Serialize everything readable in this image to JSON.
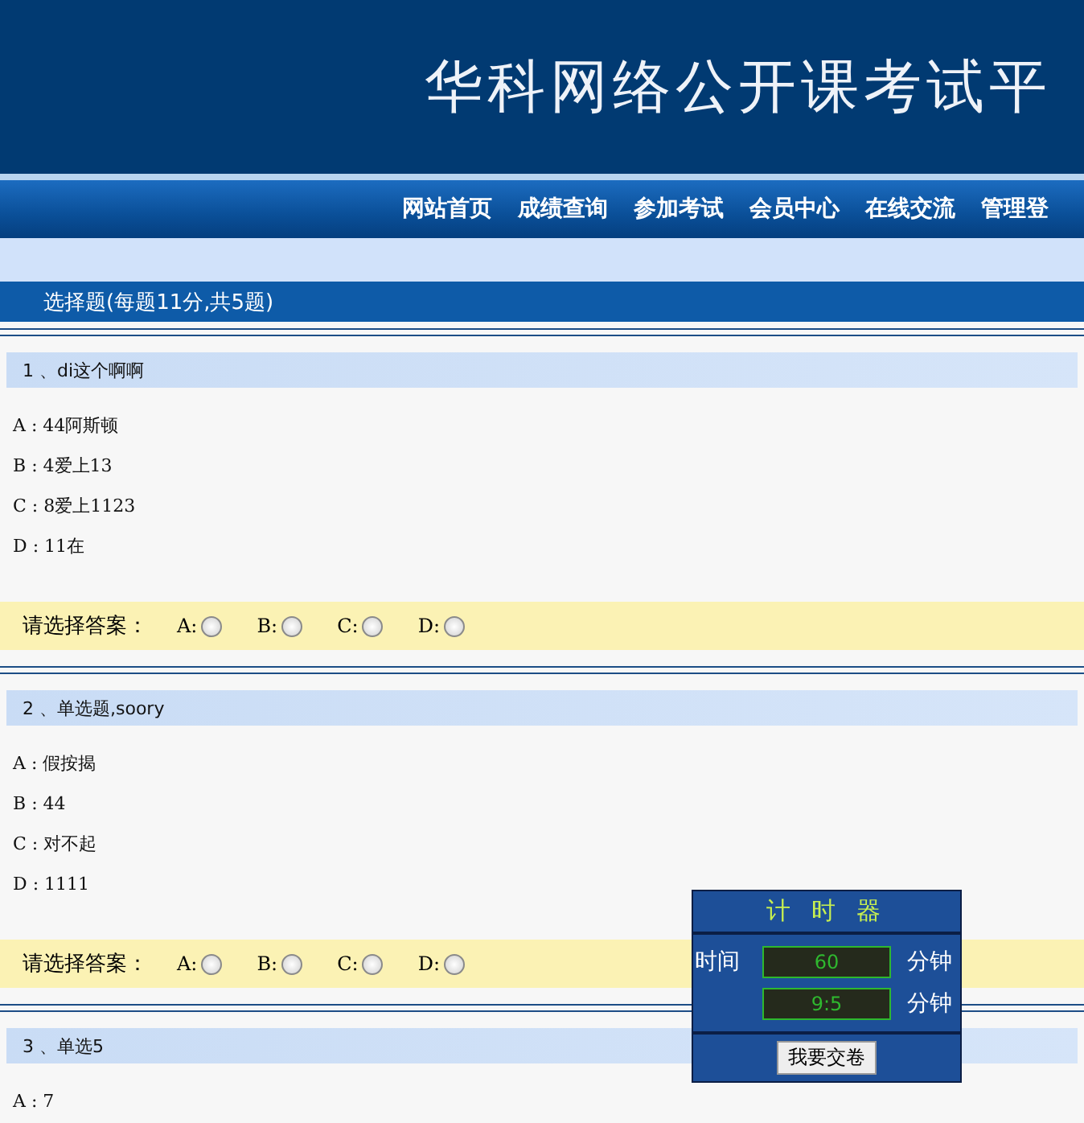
{
  "header": {
    "title": "华科网络公开课考试平"
  },
  "nav": [
    "网站首页",
    "成绩查询",
    "参加考试",
    "会员中心",
    "在线交流",
    "管理登"
  ],
  "section": {
    "title": "选择题(每题11分,共5题)"
  },
  "questions": [
    {
      "title": "1 、di这个啊啊",
      "options": [
        "A : 44阿斯顿",
        "B : 4爱上13",
        "C : 8爱上1123",
        "D : 11在"
      ],
      "prompt": "请选择答案：",
      "choices": [
        {
          "label": "A:",
          "selected": false
        },
        {
          "label": "B:",
          "selected": false
        },
        {
          "label": "C:",
          "selected": false
        },
        {
          "label": "D:",
          "selected": false
        }
      ]
    },
    {
      "title": "2 、单选题,soory",
      "options": [
        "A : 假按揭",
        "B : 44",
        "C : 对不起",
        "D : 1111"
      ],
      "prompt": "请选择答案：",
      "choices": [
        {
          "label": "A:",
          "selected": false
        },
        {
          "label": "B:",
          "selected": false
        },
        {
          "label": "C:",
          "selected": false
        },
        {
          "label": "D:",
          "selected": false
        }
      ]
    },
    {
      "title": "3 、单选5",
      "options": [
        "A : 7"
      ]
    }
  ],
  "timer": {
    "title": "计 时 器",
    "rows": [
      {
        "label": "时间",
        "value": "60",
        "unit": "分钟"
      },
      {
        "label": "",
        "value": "9:5",
        "unit": "分钟"
      }
    ],
    "button": "我要交卷"
  }
}
